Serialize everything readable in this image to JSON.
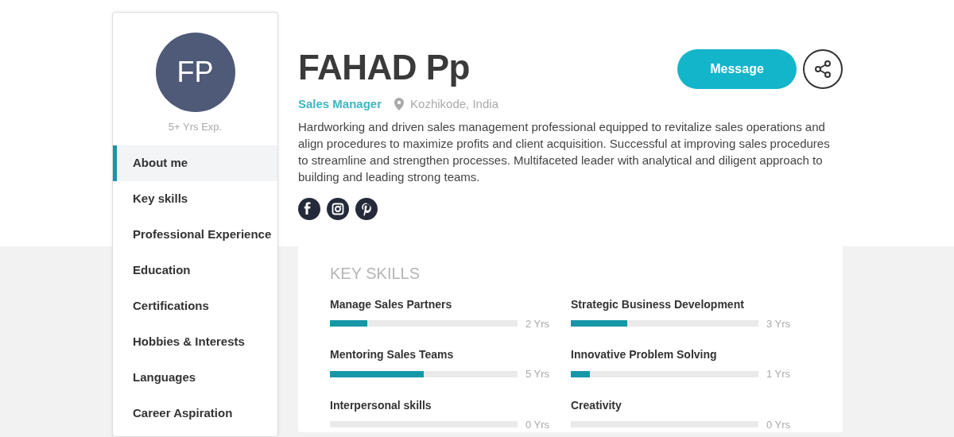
{
  "profile": {
    "initials": "FP",
    "experience": "5+ Yrs Exp.",
    "name": "FAHAD Pp",
    "role": "Sales Manager",
    "location": "Kozhikode, India",
    "summary": "Hardworking and driven sales management professional equipped to revitalize sales operations and align procedures to maximize profits and client acquisition. Successful at improving sales procedures to streamline and strengthen processes. Multifaceted leader with analytical and diligent approach to building and leading strong teams.",
    "message_button": "Message"
  },
  "sidebar": {
    "items": [
      {
        "label": "About me",
        "selected": true
      },
      {
        "label": "Key skills",
        "selected": false
      },
      {
        "label": "Professional Experience",
        "selected": false
      },
      {
        "label": "Education",
        "selected": false
      },
      {
        "label": "Certifications",
        "selected": false
      },
      {
        "label": "Hobbies & Interests",
        "selected": false
      },
      {
        "label": "Languages",
        "selected": false
      },
      {
        "label": "Career Aspiration",
        "selected": false
      }
    ]
  },
  "social": [
    {
      "kind": "facebook"
    },
    {
      "kind": "instagram"
    },
    {
      "kind": "pinterest"
    }
  ],
  "key_skills": {
    "title": "KEY SKILLS",
    "skills": [
      {
        "name": "Manage Sales Partners",
        "level": 0.2,
        "reading": "2 Yrs"
      },
      {
        "name": "Strategic Business Development",
        "level": 0.3,
        "reading": "3 Yrs"
      },
      {
        "name": "Mentoring Sales Teams",
        "level": 0.5,
        "reading": "5 Yrs"
      },
      {
        "name": "Innovative Problem Solving",
        "level": 0.1,
        "reading": "1 Yrs"
      },
      {
        "name": "Interpersonal skills",
        "level": 0,
        "reading": "0 Yrs"
      },
      {
        "name": "Creativity",
        "level": 0,
        "reading": "0 Yrs"
      }
    ]
  }
}
